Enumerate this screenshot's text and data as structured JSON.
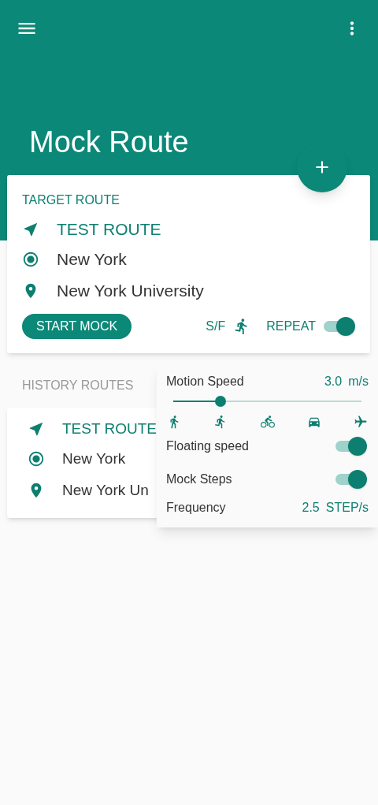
{
  "app_bar": {
    "title": "Mock Route"
  },
  "target_route": {
    "label": "TARGET ROUTE",
    "name": "TEST ROUTE",
    "from": "New York",
    "to": "New York University",
    "start_button": "START MOCK",
    "sf_label": "S/F",
    "repeat_label": "REPEAT",
    "repeat_on": true
  },
  "history": {
    "label": "HISTORY ROUTES",
    "routes": [
      {
        "name": "TEST ROUTE",
        "from": "New York",
        "to": "New York Un"
      }
    ]
  },
  "speed_panel": {
    "title": "Motion Speed",
    "value": "3.0",
    "unit": "m/s",
    "level": 0.25,
    "modes": [
      {
        "kind": "walk"
      },
      {
        "kind": "run"
      },
      {
        "kind": "bike"
      },
      {
        "kind": "car"
      },
      {
        "kind": "plane"
      }
    ],
    "toggles": [
      {
        "label": "Floating speed",
        "on": true
      },
      {
        "label": "Mock Steps",
        "on": true
      }
    ],
    "frequency": {
      "label": "Frequency",
      "value": "2.5",
      "unit": "STEP/s"
    }
  }
}
